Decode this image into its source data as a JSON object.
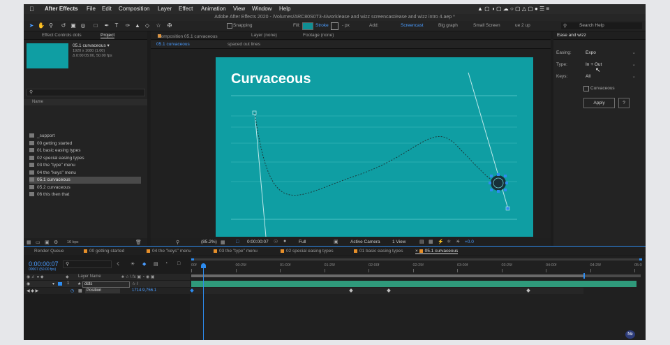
{
  "menubar": {
    "app": "After Effects",
    "items": [
      "File",
      "Edit",
      "Composition",
      "Layer",
      "Effect",
      "Animation",
      "View",
      "Window",
      "Help"
    ]
  },
  "titlebar": {
    "text": "Adobe After Effects 2020 - /Volumes/ARC80S0T3-4/work/ease and wizz screencast/ease and wizz intro 4.aep *"
  },
  "toolbar": {
    "snapping": "Snapping",
    "fill": "Fill:",
    "stroke": "Stroke",
    "px": "- px",
    "add": "Add:",
    "workspaces": [
      "Screencast",
      "Big graph",
      "Small Screen",
      "ue 2 up"
    ],
    "search_help": "Search Help"
  },
  "project_panel": {
    "tabs": [
      "Effect Controls dots",
      "Project"
    ],
    "comp_name": "05.1 curvaceous ▾",
    "comp_res": "1920 x 1080 (1.00)",
    "comp_dur": "Δ 0:00:05:00, 50.00 fps",
    "column_name": "Name",
    "items": [
      {
        "label": "_support",
        "selected": false
      },
      {
        "label": "00 getting started",
        "selected": false
      },
      {
        "label": "01 basic easing types",
        "selected": false
      },
      {
        "label": "02 special easing types",
        "selected": false
      },
      {
        "label": "03 the \"type\" menu",
        "selected": false
      },
      {
        "label": "04 the \"keys\" menu",
        "selected": false
      },
      {
        "label": "05.1 curvaceous",
        "selected": true
      },
      {
        "label": "05.2 curvaceous",
        "selected": false
      },
      {
        "label": "06 this then that",
        "selected": false
      }
    ],
    "bpc": "16 bpc"
  },
  "comp_panel": {
    "tab": "Composition 05.1 curvaceous",
    "layer": "Layer (none)",
    "footage": "Footage (none)",
    "subtabs": [
      "05.1 curvaceous",
      "spaced out lines"
    ],
    "title": "Curvaceous",
    "zoom": "(85.2%)",
    "timecode": "0:00:00:07",
    "resolution": "Full",
    "camera": "Active Camera",
    "view": "1 View",
    "exposure": "+0.0"
  },
  "ease_panel": {
    "title": "Ease and wizz",
    "easing_label": "Easing:",
    "easing_value": "Expo",
    "type_label": "Type:",
    "type_value": "In + Out",
    "keys_label": "Keys:",
    "keys_value": "All",
    "checkbox_label": "Curvaceous",
    "apply": "Apply",
    "help": "?"
  },
  "timeline": {
    "tabs": [
      "Render Queue",
      "00 getting started",
      "04 the \"keys\" menu",
      "03 the \"type\" menu",
      "02 special easing types",
      "01 basic easing types",
      "05.1 curvaceous"
    ],
    "timecode": "0:00:00:07",
    "timecode_sub": "00007 (50.00 fps)",
    "col_layer_name": "Layer Name",
    "layer_num": "1",
    "layer_name": "dots",
    "prop_name": "Position",
    "prop_value": "1714.9,756.1",
    "ruler": [
      "00f",
      "00:25f",
      "01:00f",
      "01:25f",
      "02:00f",
      "02:25f",
      "03:00f",
      "03:25f",
      "04:00f",
      "04:25f",
      "05:0"
    ]
  },
  "colors": {
    "comp_bg": "#0f9ea3",
    "accent_blue": "#2d8cf0",
    "track_green": "#2f9a7b"
  }
}
